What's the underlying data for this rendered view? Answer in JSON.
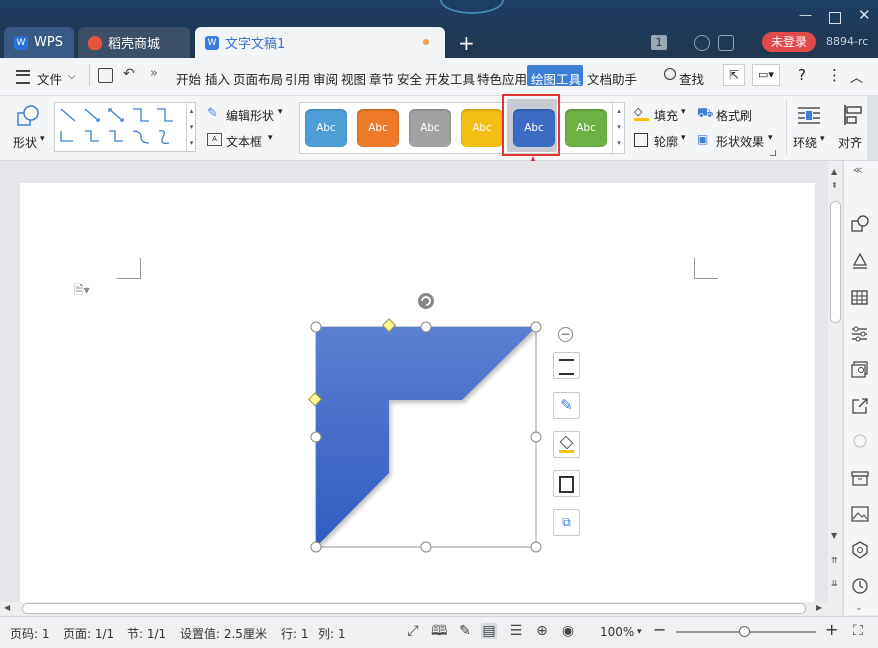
{
  "titlebar": {
    "tabs": [
      {
        "label": "WPS"
      },
      {
        "label": "稻壳商城"
      },
      {
        "label": "文字文稿1"
      }
    ],
    "window_count": "1",
    "login_label": "未登录",
    "user_id": "8894-rc"
  },
  "menu": {
    "file_label": "文件",
    "items": [
      "开始",
      "插入",
      "页面布局",
      "引用",
      "审阅",
      "视图",
      "章节",
      "安全",
      "开发工具",
      "特色应用",
      "绘图工具",
      "文档助手"
    ],
    "active_item": "绘图工具",
    "search_label": "查找"
  },
  "ribbon": {
    "shape_label": "形状",
    "edit_shape_label": "编辑形状",
    "textbox_label": "文本框",
    "styles": [
      {
        "label": "Abc",
        "color": "#4e9fd8"
      },
      {
        "label": "Abc",
        "color": "#ee7a2a"
      },
      {
        "label": "Abc",
        "color": "#a2a2a2"
      },
      {
        "label": "Abc",
        "color": "#f4be14"
      },
      {
        "label": "Abc",
        "color": "#3d6cc4"
      },
      {
        "label": "Abc",
        "color": "#6db144"
      }
    ],
    "selected_style_index": 4,
    "fill_label": "填充",
    "outline_label": "轮廓",
    "format_brush_label": "格式刷",
    "shape_effect_label": "形状效果",
    "wrap_label": "环绕",
    "align_label": "对齐"
  },
  "shape": {
    "fill_top": "#5b80d2",
    "fill_bottom": "#2f5cc0"
  },
  "statusbar": {
    "page_num": "页码: 1",
    "pages": "页面: 1/1",
    "section": "节: 1/1",
    "setting": "设置值: 2.5厘米",
    "row": "行: 1",
    "col": "列: 1",
    "zoom": "100%",
    "zoom_level": 0.49
  },
  "colors": {
    "accent": "#3d7fd6",
    "highlight": "#e23434"
  }
}
